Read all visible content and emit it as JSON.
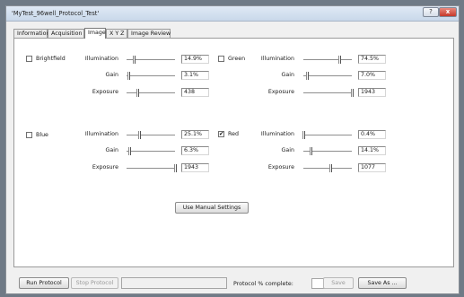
{
  "window": {
    "title": "'MyTest_96well_Protocol_Test'",
    "help_label": "?",
    "close_label": "x"
  },
  "tabs": [
    {
      "label": "Information"
    },
    {
      "label": "Acquisition"
    },
    {
      "label": "Image"
    },
    {
      "label": "X Y Z"
    },
    {
      "label": "Image Review"
    }
  ],
  "channels": {
    "brightfield": {
      "label": "Brightfield",
      "checked": false,
      "illumination_label": "Illumination",
      "illumination_value": "14.9%",
      "illumination_pos": 0.149,
      "gain_label": "Gain",
      "gain_value": "3.1%",
      "gain_pos": 0.031,
      "exposure_label": "Exposure",
      "exposure_value": "438",
      "exposure_pos": 0.23
    },
    "green": {
      "label": "Green",
      "checked": false,
      "illumination_label": "Illumination",
      "illumination_value": "74.5%",
      "illumination_pos": 0.745,
      "gain_label": "Gain",
      "gain_value": "7.0%",
      "gain_pos": 0.07,
      "exposure_label": "Exposure",
      "exposure_value": "1943",
      "exposure_pos": 1.0
    },
    "blue": {
      "label": "Blue",
      "checked": false,
      "illumination_label": "Illumination",
      "illumination_value": "25.1%",
      "illumination_pos": 0.251,
      "gain_label": "Gain",
      "gain_value": "6.3%",
      "gain_pos": 0.063,
      "exposure_label": "Exposure",
      "exposure_value": "1943",
      "exposure_pos": 1.0
    },
    "red": {
      "label": "Red",
      "checked": true,
      "illumination_label": "Illumination",
      "illumination_value": "0.4%",
      "illumination_pos": 0.004,
      "gain_label": "Gain",
      "gain_value": "14.1%",
      "gain_pos": 0.141,
      "exposure_label": "Exposure",
      "exposure_value": "1077",
      "exposure_pos": 0.55
    }
  },
  "buttons": {
    "use_manual": "Use Manual Settings",
    "run": "Run Protocol",
    "stop": "Stop Protocol",
    "save": "Save",
    "save_as": "Save As ..."
  },
  "status": {
    "complete_label": "Protocol % complete:"
  }
}
